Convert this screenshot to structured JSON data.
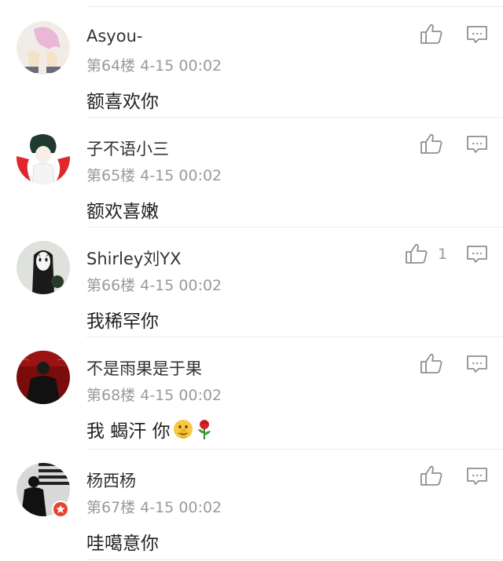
{
  "comments": [
    {
      "user": "Asyou-",
      "floor": "第64楼",
      "time": "4-15 00:02",
      "text": "额喜欢你",
      "likes": ""
    },
    {
      "user": "子不语小三",
      "floor": "第65楼",
      "time": "4-15 00:02",
      "text": "额欢喜嫩",
      "likes": ""
    },
    {
      "user": "Shirley刘YX",
      "floor": "第66楼",
      "time": "4-15 00:02",
      "text": "我稀罕你",
      "likes": "1"
    },
    {
      "user": "不是雨果是于果",
      "floor": "第68楼",
      "time": "4-15 00:02",
      "text": "我 蝎汗 你",
      "likes": ""
    },
    {
      "user": "杨西杨",
      "floor": "第67楼",
      "time": "4-15 00:02",
      "text": "哇噶意你",
      "likes": ""
    }
  ],
  "icons": {
    "like": "thumbs-up-icon",
    "reply": "comment-icon",
    "emoji_1": "shushing-face-emoji",
    "emoji_2": "rose-emoji"
  },
  "colors": {
    "meta_text": "#9a9a9a",
    "badge": "#e8412e"
  }
}
